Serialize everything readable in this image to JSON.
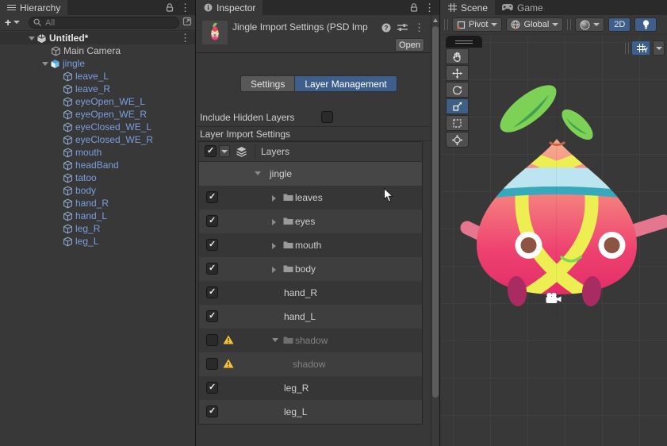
{
  "app": {
    "accent_selected": "#3E5F8C",
    "panel_bg": "#383838",
    "tabbar_bg": "#2A2A2A"
  },
  "icons": {
    "hierarchy_tab": "list-icon",
    "inspector_tab": "info-icon",
    "scene_tab": "grid-icon",
    "game_tab": "gamepad-icon",
    "lock": "padlock-icon",
    "menu": "kebab-menu-icon",
    "search": "magnifier-icon",
    "popout": "open-in-window-icon",
    "warning": "warning-triangle-icon",
    "folder": "folder-icon",
    "layers": "layers-icon",
    "camera_gizmo": "camera-icon",
    "help": "help-circle-icon",
    "presets": "presets-sliders-icon"
  },
  "hierarchy": {
    "tab_label": "Hierarchy",
    "add_button": "+",
    "search_placeholder": "All",
    "items": [
      {
        "label": "Untitled*",
        "depth": 0,
        "kind": "scene",
        "expanded": true
      },
      {
        "label": "Main Camera",
        "depth": 1,
        "kind": "gameobject"
      },
      {
        "label": "jingle",
        "depth": 1,
        "kind": "prefab-root",
        "expanded": true
      },
      {
        "label": "leave_L",
        "depth": 2,
        "kind": "prefab-child"
      },
      {
        "label": "leave_R",
        "depth": 2,
        "kind": "prefab-child"
      },
      {
        "label": "eyeOpen_WE_L",
        "depth": 2,
        "kind": "prefab-child"
      },
      {
        "label": "eyeOpen_WE_R",
        "depth": 2,
        "kind": "prefab-child"
      },
      {
        "label": "eyeClosed_WE_L",
        "depth": 2,
        "kind": "prefab-child"
      },
      {
        "label": "eyeClosed_WE_R",
        "depth": 2,
        "kind": "prefab-child"
      },
      {
        "label": "mouth",
        "depth": 2,
        "kind": "prefab-child"
      },
      {
        "label": "headBand",
        "depth": 2,
        "kind": "prefab-child"
      },
      {
        "label": "tatoo",
        "depth": 2,
        "kind": "prefab-child"
      },
      {
        "label": "body",
        "depth": 2,
        "kind": "prefab-child"
      },
      {
        "label": "hand_R",
        "depth": 2,
        "kind": "prefab-child"
      },
      {
        "label": "hand_L",
        "depth": 2,
        "kind": "prefab-child"
      },
      {
        "label": "leg_R",
        "depth": 2,
        "kind": "prefab-child"
      },
      {
        "label": "leg_L",
        "depth": 2,
        "kind": "prefab-child"
      }
    ]
  },
  "inspector": {
    "tab_label": "Inspector",
    "title": "Jingle Import Settings (PSD Imp",
    "open_button": "Open",
    "tabs": [
      {
        "label": "Settings",
        "active": false
      },
      {
        "label": "Layer Management",
        "active": true
      }
    ],
    "include_hidden": {
      "label": "Include Hidden Layers",
      "checked": false
    },
    "section_title": "Layer Import Settings",
    "table": {
      "header": "Layers",
      "rows": [
        {
          "name": "jingle",
          "kind": "root",
          "expanded": true
        },
        {
          "name": "leaves",
          "kind": "group",
          "checked": true
        },
        {
          "name": "eyes",
          "kind": "group",
          "checked": true
        },
        {
          "name": "mouth",
          "kind": "group",
          "checked": true
        },
        {
          "name": "body",
          "kind": "group",
          "checked": true
        },
        {
          "name": "hand_R",
          "kind": "layer",
          "checked": true
        },
        {
          "name": "hand_L",
          "kind": "layer",
          "checked": true
        },
        {
          "name": "shadow",
          "kind": "group",
          "checked": false,
          "warning": true,
          "expanded": true
        },
        {
          "name": "shadow",
          "kind": "sublayer",
          "checked": false,
          "warning": true
        },
        {
          "name": "leg_R",
          "kind": "layer",
          "checked": true
        },
        {
          "name": "leg_L",
          "kind": "layer",
          "checked": true
        }
      ]
    }
  },
  "scene": {
    "tab_label": "Scene",
    "game_tab_label": "Game",
    "toolbar": {
      "pivot": "Pivot",
      "global": "Global",
      "mode_2d": "2D"
    },
    "grid_axis": "Y",
    "character": {
      "name": "jingle",
      "colors": {
        "leaf": "#7ED157",
        "leaf_vein": "#44A14B",
        "body_top": "#F7AD8E",
        "body_bottom": "#E22E67",
        "stripe": "#EDEE52",
        "band": "#BCE4F1",
        "band_stripe": "#36A9BD",
        "eye_ring": "#FFFFFF",
        "eye_iris": "#8C5441",
        "mouth": "#7FD557",
        "arm": "#E5768F",
        "leg": "#A82B61"
      }
    }
  }
}
